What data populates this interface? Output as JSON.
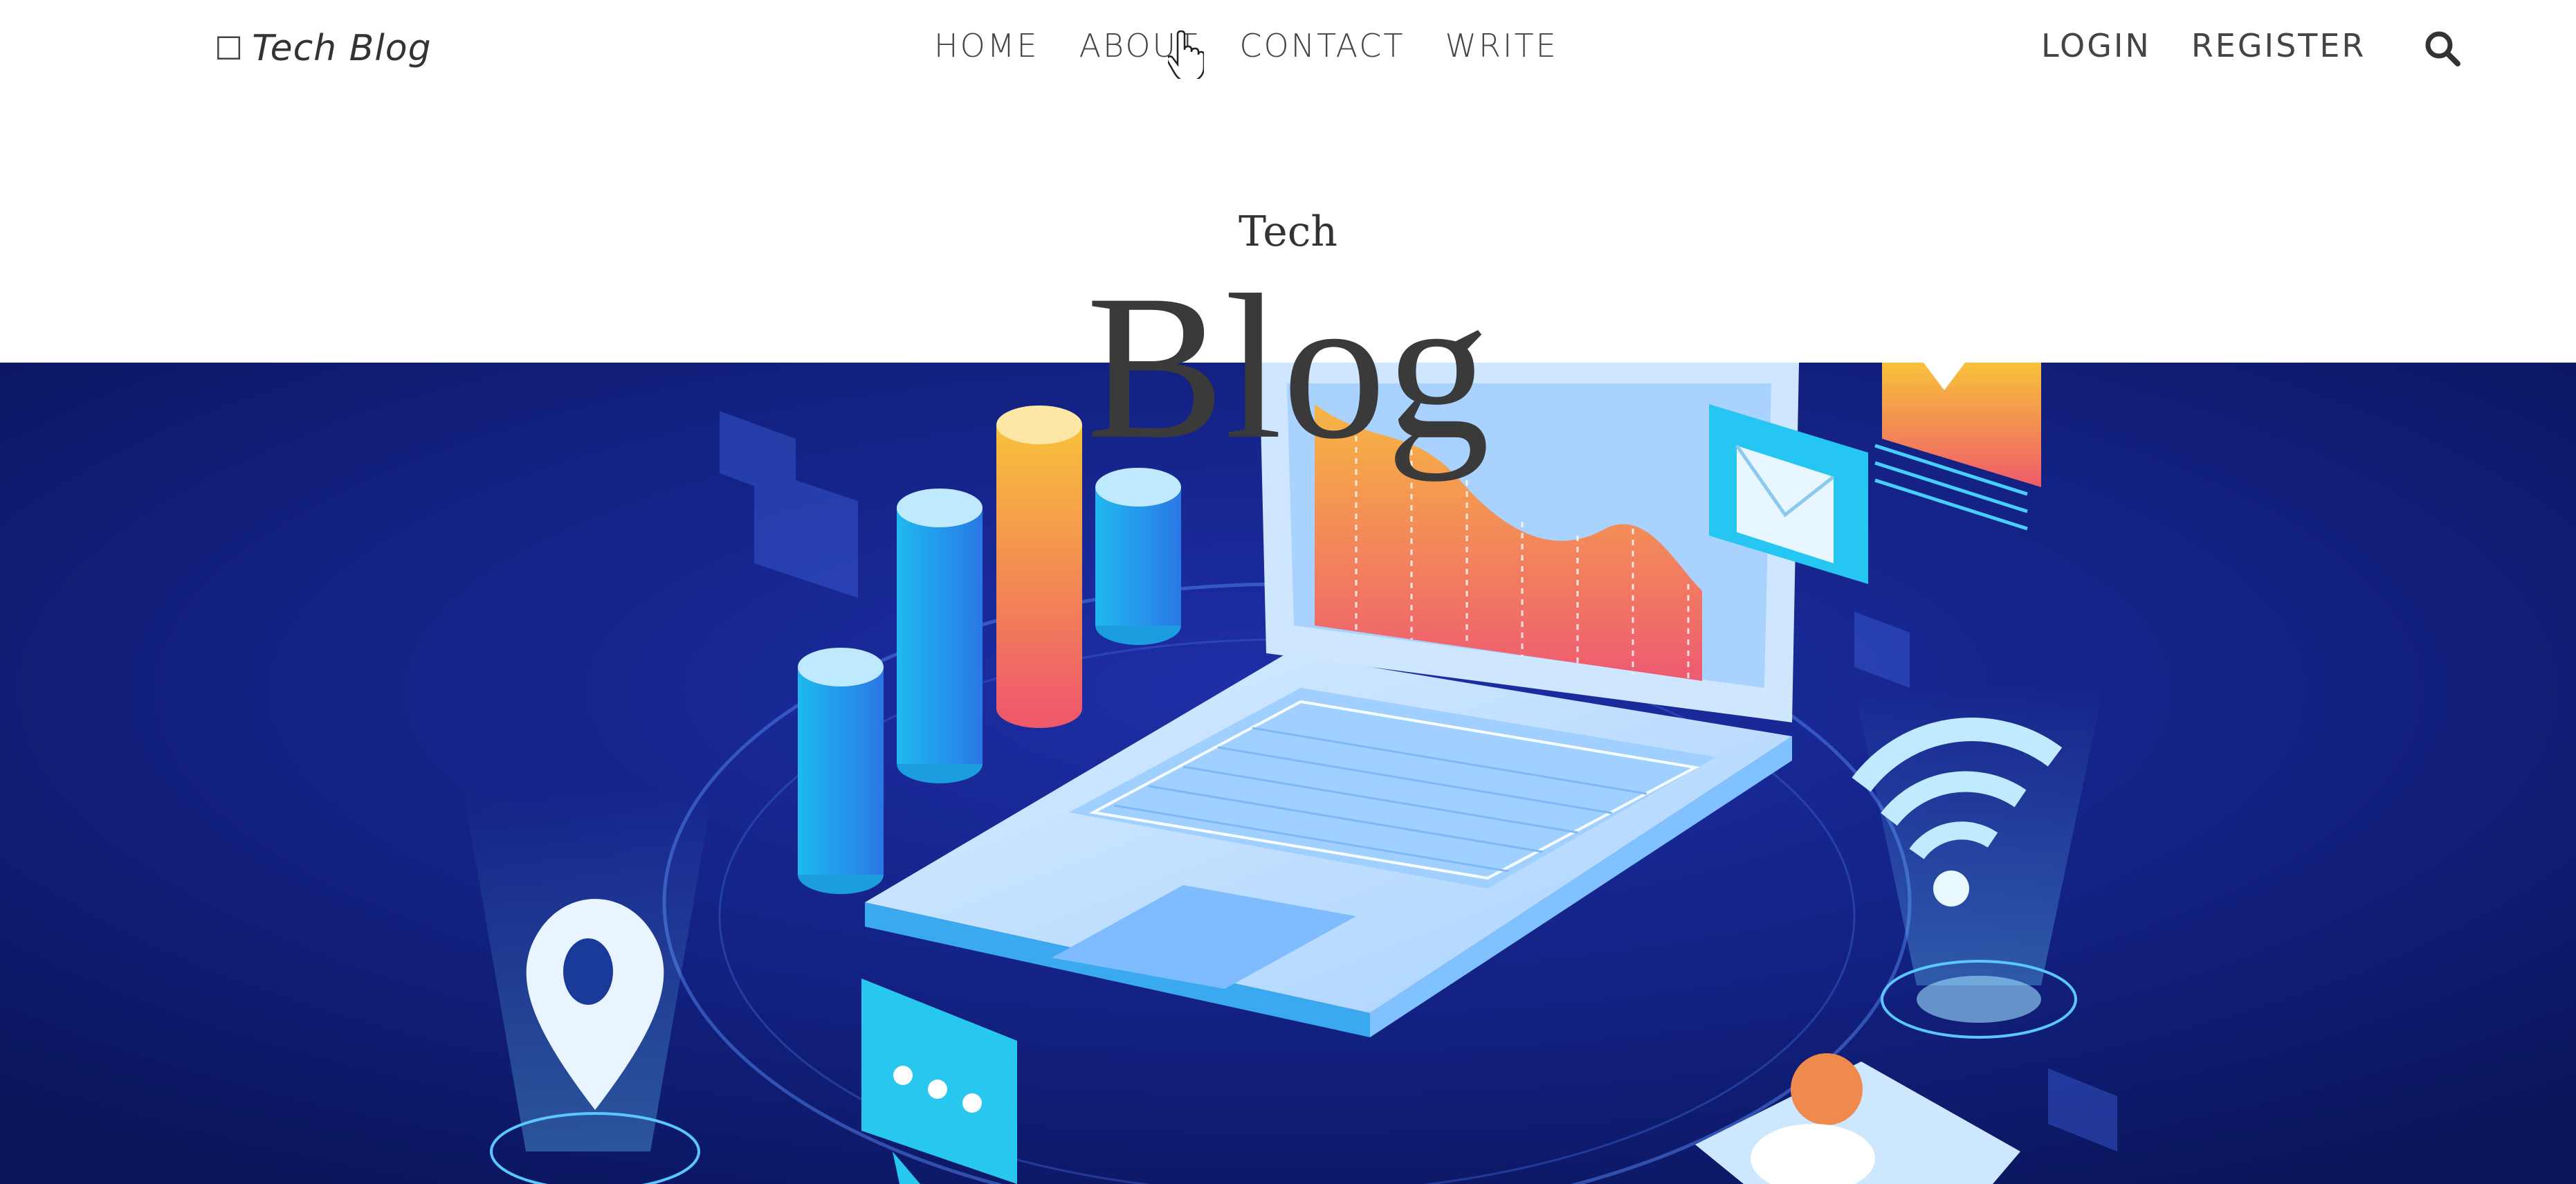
{
  "header": {
    "brand_icon": "camera-icon",
    "brand_label": "Tech Blog",
    "nav": [
      {
        "label": "HOME"
      },
      {
        "label": "ABOUT"
      },
      {
        "label": "CONTACT"
      },
      {
        "label": "WRITE"
      }
    ],
    "auth": [
      {
        "label": "LOGIN"
      },
      {
        "label": "REGISTER"
      }
    ],
    "search_icon": "search-icon"
  },
  "hero_title": {
    "small": "Tech",
    "large": "Blog"
  },
  "hero_image": {
    "description_icon": "isometric-laptop-analytics-illustration"
  },
  "colors": {
    "hero_bg": "#0b1a6b",
    "nav_text": "#444444",
    "title_text": "#3a3a3a"
  }
}
